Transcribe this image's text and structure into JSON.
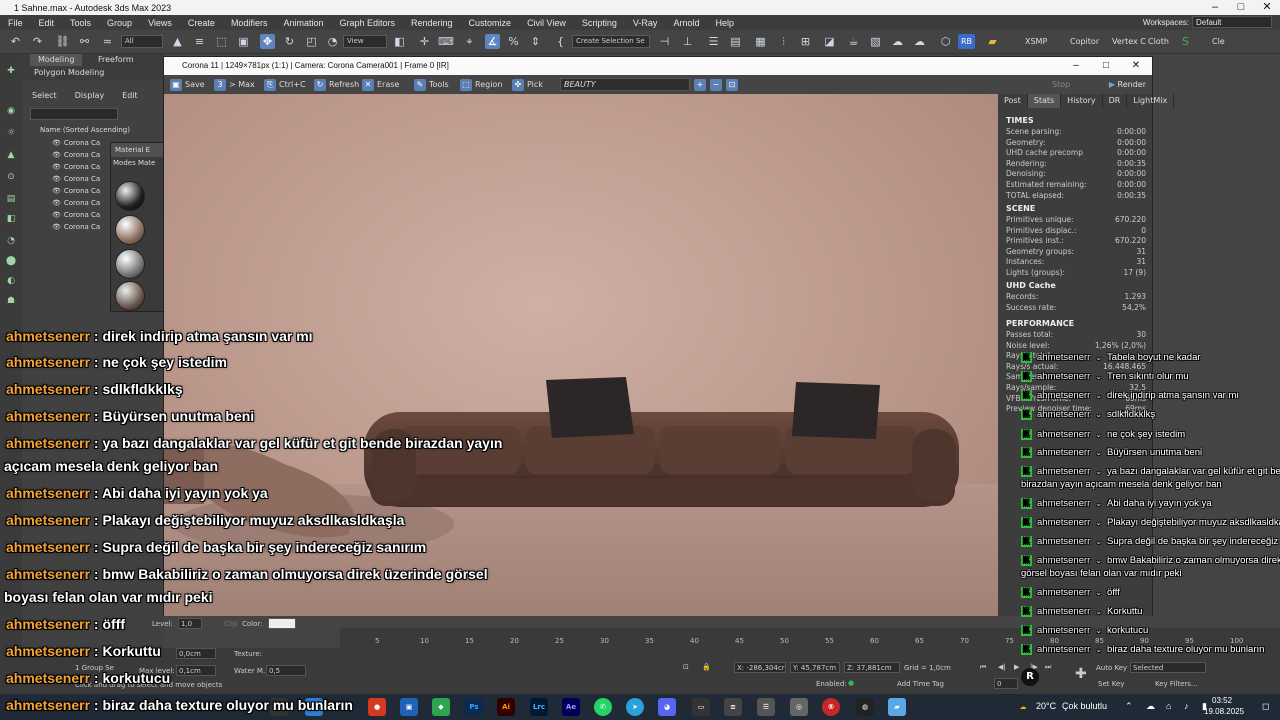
{
  "window": {
    "title": "1 Sahne.max - Autodesk 3ds Max 2023"
  },
  "menu": [
    "File",
    "Edit",
    "Tools",
    "Group",
    "Views",
    "Create",
    "Modifiers",
    "Animation",
    "Graph Editors",
    "Rendering",
    "Customize",
    "Civil View",
    "Scripting",
    "V-Ray",
    "Arnold",
    "Help"
  ],
  "workspace": {
    "label": "Workspaces:",
    "value": "Default"
  },
  "toolbar": {
    "filter": "All",
    "view": "View",
    "selection_set": "Create Selection Se",
    "xsmp": "XSMP",
    "copitor": "Copitor",
    "vertex": "Vertex C",
    "cloth": "Cloth",
    "cle": "Cle"
  },
  "ribbon": {
    "tab1": "Modeling",
    "tab2": "Freeform",
    "sub": "Polygon Modeling"
  },
  "scene_explorer": {
    "menu": [
      "Select",
      "Display",
      "Edit"
    ],
    "header": "Name (Sorted Ascending)",
    "rows": [
      "Corona Ca",
      "Corona Ca",
      "Corona Ca",
      "Corona Ca",
      "Corona Ca",
      "Corona Ca",
      "Corona Ca",
      "Corona Ca"
    ]
  },
  "material_editor": {
    "title": "Material E",
    "menu1": "Modes",
    "menu2": "Mate"
  },
  "vfb": {
    "title": "Corona 11 | 1249×781px (1:1) | Camera: Corona Camera001 | Frame 0 [IR]",
    "tools": {
      "save": "Save",
      "tomax": "> Max",
      "ctrlc": "Ctrl+C",
      "refresh": "Refresh",
      "erase": "Erase",
      "tools": "Tools",
      "region": "Region",
      "pick": "Pick",
      "beauty": "BEAUTY",
      "stop": "Stop",
      "render": "Render"
    },
    "tabs": [
      "Post",
      "Stats",
      "History",
      "DR",
      "LightMix"
    ],
    "sections": [
      {
        "title": "TIMES",
        "rows": [
          [
            "Scene parsing:",
            "0:00:00"
          ],
          [
            "Geometry:",
            "0:00:00"
          ],
          [
            "UHD cache precomp",
            "0:00:00"
          ],
          [
            "Rendering:",
            "0:00:35"
          ],
          [
            "Denoising:",
            "0:00:00"
          ],
          [
            "Estimated remaining:",
            "0:00:00"
          ],
          [
            "TOTAL elapsed:",
            "0:00:35"
          ]
        ]
      },
      {
        "title": "SCENE",
        "rows": [
          [
            "Primitives unique:",
            "670.220"
          ],
          [
            "Primitives displac.:",
            "0"
          ],
          [
            "Primitives inst.:",
            "670.220"
          ],
          [
            "Geometry groups:",
            "31"
          ],
          [
            "Instances:",
            "31"
          ],
          [
            "Lights (groups):",
            "17 (9)"
          ]
        ]
      },
      {
        "title": "UHD Cache",
        "rows": [
          [
            "Records:",
            "1.293"
          ],
          [
            "Success rate:",
            "54,2%"
          ]
        ]
      },
      {
        "title": "PERFORMANCE",
        "rows": [
          [
            "Passes total:",
            "30"
          ],
          [
            "Noise level:",
            "1,26% (2,0%)"
          ],
          [
            "Rays/s total:",
            ""
          ],
          [
            "Rays/s actual:",
            "16.448.465"
          ],
          [
            "Samples/s:",
            ""
          ],
          [
            "Rays/sample:",
            "32,5"
          ],
          [
            "VFB refresh time:",
            "69ms"
          ],
          [
            "Preview denoiser time:",
            "69ms"
          ]
        ]
      }
    ]
  },
  "timeline": {
    "ticks": [
      "5",
      "10",
      "15",
      "20",
      "25",
      "30",
      "35",
      "40",
      "45",
      "50",
      "55",
      "60",
      "65",
      "70",
      "75",
      "80",
      "85",
      "90",
      "95",
      "100"
    ]
  },
  "status": {
    "x": "X: -286,304cr",
    "y": "Y: 45,787cm",
    "z": "Z: 37,881cm",
    "grid": "Grid = 1,0cm",
    "enabled": "Enabled:",
    "add_time_tag": "Add Time Tag",
    "auto_key": "Auto Key",
    "selected": "Selected",
    "set_key": "Set Key",
    "key_filters": "Key Filters...",
    "group": "1 Group Se",
    "prompt": "Click and drag to select and move objects",
    "frame": "0",
    "level": "Level:",
    "level_val": "1,0",
    "clip": "Clip",
    "color": "Color:",
    "coord": "0,0cm",
    "texture": "Texture:",
    "max_level": "Max level:",
    "max_level_val": "0,1cm",
    "water": "Water M.",
    "water_val": "0,5"
  },
  "taskbar": {
    "weather_temp": "20°C",
    "weather": "Çok bulutlu",
    "time": "03:52",
    "date": "19.08.2025"
  },
  "chat_left": [
    {
      "user": "ahmetsenerr",
      "msg": " : direk indirip atma şansın var mı"
    },
    {
      "user": "ahmetsenerr",
      "msg": " : ne çok şey istedim"
    },
    {
      "user": "ahmetsenerr",
      "msg": " : sdlkfldkklkş"
    },
    {
      "user": "ahmetsenerr",
      "msg": " : Büyürsen unutma beni"
    },
    {
      "user": "ahmetsenerr",
      "msg": " : ya bazı dangalaklar var gel küfür et git bende birazdan yayın"
    },
    {
      "user": "",
      "msg": "açıcam mesela denk geliyor ban"
    },
    {
      "user": "ahmetsenerr",
      "msg": " : Abi daha iyi yayın yok ya"
    },
    {
      "user": "ahmetsenerr",
      "msg": " : Plakayı değiştebiliyor muyuz aksdlkasldkaşla"
    },
    {
      "user": "ahmetsenerr",
      "msg": " : Supra değil de başka bir şey indereceğiz sanırım"
    },
    {
      "user": "ahmetsenerr",
      "msg": " : bmw Bakabiliriz o zaman olmuyorsa direk üzerinde görsel"
    },
    {
      "user": "",
      "msg": "boyası felan olan var mıdır peki"
    },
    {
      "user": "ahmetsenerr",
      "msg": " : öfff"
    },
    {
      "user": "ahmetsenerr",
      "msg": " : Korkuttu"
    },
    {
      "user": "ahmetsenerr",
      "msg": " : korkutucu"
    },
    {
      "user": "ahmetsenerr",
      "msg": " : biraz daha texture oluyor mu bunların"
    }
  ],
  "chat_right": [
    {
      "user": "ahmetsenerr",
      "msg": "Tabela boyut ne kadar"
    },
    {
      "user": "ahmetsenerr",
      "msg": "Tren sıkıntı olur mu"
    },
    {
      "user": "ahmetsenerr",
      "msg": "direk indirip atma şansın var mı"
    },
    {
      "user": "ahmetsenerr",
      "msg": "sdlkfldkklkş"
    },
    {
      "user": "ahmetsenerr",
      "msg": "ne çok şey istedim"
    },
    {
      "user": "ahmetsenerr",
      "msg": "Büyürsen unutma beni"
    },
    {
      "user": "ahmetsenerr",
      "msg": "ya bazı dangalaklar var gel küfür et git be",
      "cont": "birazdan yayın açıcam mesela denk geliyor ban"
    },
    {
      "user": "ahmetsenerr",
      "msg": "Abi daha iyi yayın yok ya"
    },
    {
      "user": "ahmetsenerr",
      "msg": "Plakayı değiştebiliyor muyuz aksdlkasldkaş"
    },
    {
      "user": "ahmetsenerr",
      "msg": "Supra değil de başka bir şey indereceğiz"
    },
    {
      "user": "ahmetsenerr",
      "msg": "bmw Bakabiliriz o zaman olmuyorsa direk",
      "cont": "görsel boyası felan olan var mıdır peki"
    },
    {
      "user": "ahmetsenerr",
      "msg": "öfff"
    },
    {
      "user": "ahmetsenerr",
      "msg": "Korkuttu"
    },
    {
      "user": "ahmetsenerr",
      "msg": "korkutucu"
    },
    {
      "user": "ahmetsenerr",
      "msg": "biraz daha texture oluyor mu bunların"
    }
  ],
  "colors": {
    "chat_user": "#f2a33a",
    "kick_green": "#2fbf3a",
    "render_bg": "#c7a69a",
    "sofa": "#5a3e34"
  }
}
